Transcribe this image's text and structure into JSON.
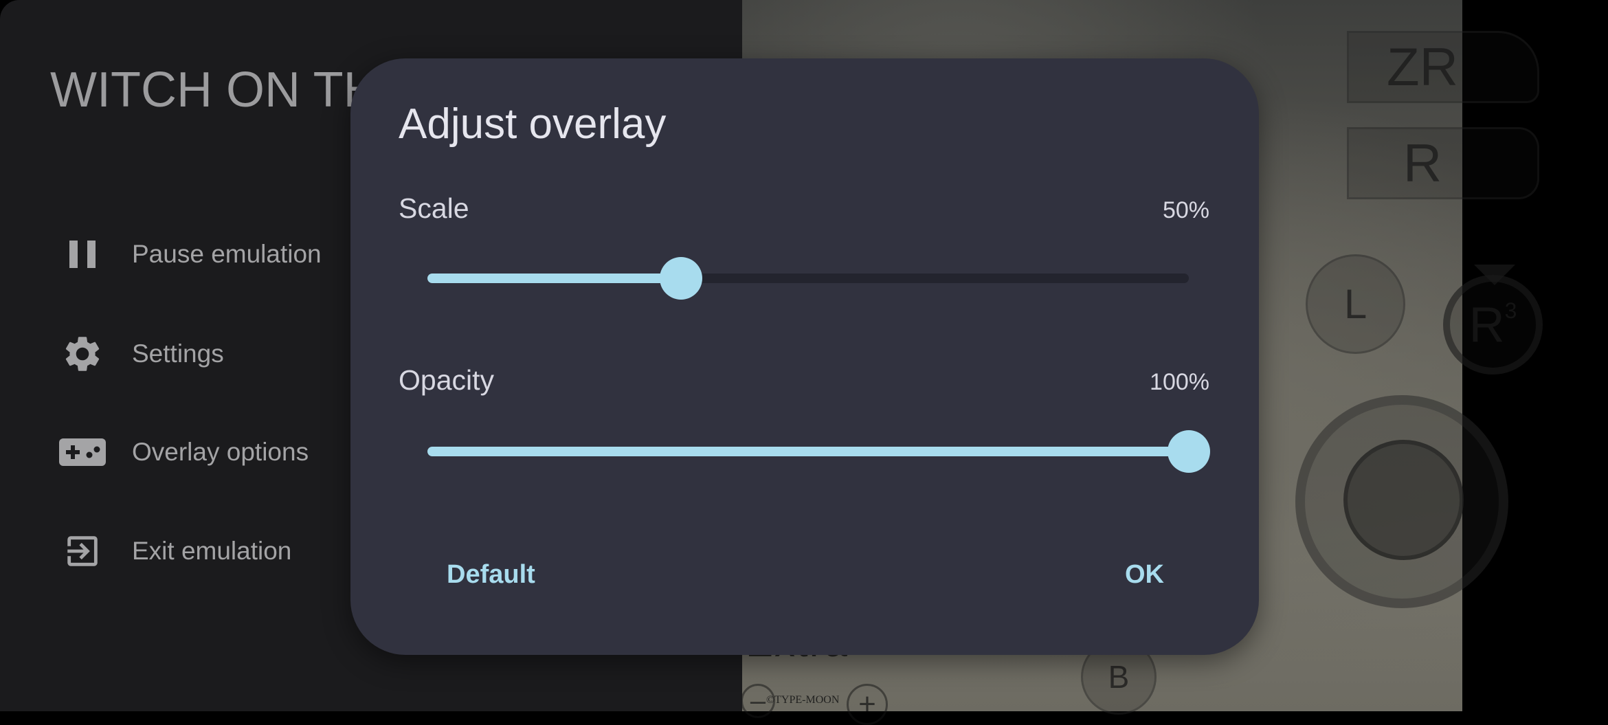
{
  "game_overlay": {
    "zr_label": "ZR",
    "r_label": "R",
    "l3_label": "L",
    "r3_label": "R",
    "r3_sup": "3",
    "b_label": "B",
    "background_text": "Extra",
    "copyright": "©TYPE-MOON",
    "plus_label": "+"
  },
  "drawer": {
    "game_title": "WITCH ON THE HOLY NIGHT",
    "menu": [
      {
        "label": "Pause emulation",
        "icon": "pause-icon"
      },
      {
        "label": "Settings",
        "icon": "gear-icon"
      },
      {
        "label": "Overlay options",
        "icon": "gamepad-icon"
      },
      {
        "label": "Exit emulation",
        "icon": "exit-icon"
      }
    ]
  },
  "dialog": {
    "title": "Adjust overlay",
    "scale": {
      "label": "Scale",
      "value_text": "50%",
      "value": 50,
      "min": 0,
      "max": 150
    },
    "opacity": {
      "label": "Opacity",
      "value_text": "100%",
      "value": 100,
      "min": 0,
      "max": 100
    },
    "default_button": "Default",
    "ok_button": "OK"
  },
  "colors": {
    "accent": "#a8dcee",
    "dialog_bg": "#31323f",
    "drawer_bg": "#1b1b1d"
  }
}
